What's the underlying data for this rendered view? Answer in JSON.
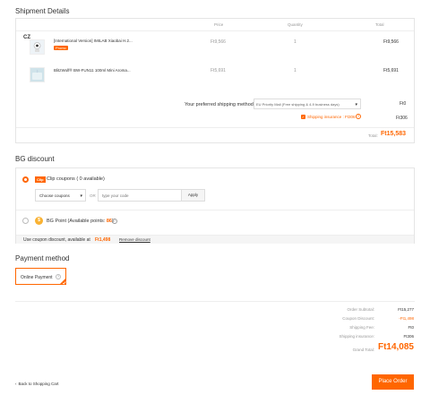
{
  "shipment": {
    "title": "Shipment Details",
    "columns": [
      "Price",
      "Quantity",
      "Total"
    ],
    "warehouse": "CZ",
    "items": [
      {
        "name": "[International Version] IMILAB Xiaobai H.2...",
        "tag": "Promo",
        "price": "Ft9,566",
        "qty": "1",
        "total": "Ft9,566"
      },
      {
        "name": "BlitzWolf® BW-FUN11 100ml Mini Aroma...",
        "tag": "",
        "price": "Ft5,691",
        "qty": "1",
        "total": "Ft5,691"
      }
    ],
    "shipping_label": "Your preferred shipping method:",
    "shipping_option": "EU Priority Mail (Free shipping & 4-9 business days)",
    "shipping_cost": "Ft0",
    "insurance_label": "Shipping insurance : Ft306",
    "insurance_cost": "Ft306",
    "total_label": "Total:",
    "total_value": "Ft15,583"
  },
  "discount": {
    "title": "BG discount",
    "coupon_badge": "Clip",
    "coupon_label": "Clip coupons ( 0 available)",
    "select_placeholder": "Choose coupons",
    "or_text": "OR",
    "code_placeholder": "type your code",
    "apply_label": "Apply",
    "points_label": "BG Point (Available points:",
    "points_value": "86",
    "points_close": ")",
    "note": "Use coupon discount, available at",
    "note_amount": "Ft1,498",
    "remove_label": "Remove discount"
  },
  "payment": {
    "title": "Payment method",
    "option": "Online Payment"
  },
  "summary": {
    "rows": [
      {
        "label": "Order Subtotal:",
        "value": "Ft15,277"
      },
      {
        "label": "Coupon Discount:",
        "value": "-Ft1,498"
      },
      {
        "label": "Shipping Fee:",
        "value": "Ft0"
      },
      {
        "label": "Shipping insurance:",
        "value": "Ft306"
      }
    ],
    "grand_label": "Grand Total:",
    "grand_value": "Ft14,085"
  },
  "footer": {
    "back_label": "Back to Shopping Cart",
    "place_order": "Place Order"
  },
  "colors": {
    "accent": "#ff6600",
    "border": "#e5e5e5"
  }
}
